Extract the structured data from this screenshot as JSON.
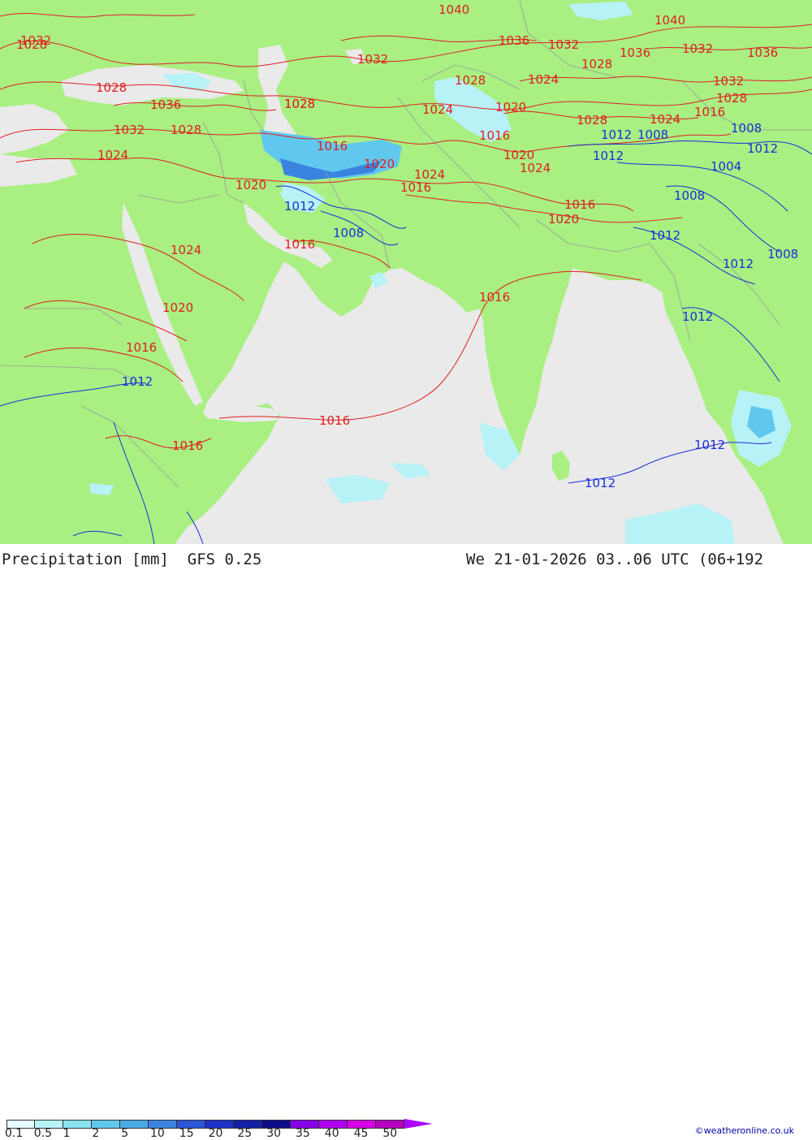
{
  "colors": {
    "land": "#a9ef82",
    "sea": "#eaeaea",
    "high_pressure_isobar": "#e02020",
    "low_pressure_isobar": "#1a2fd6",
    "precip_light": "#b7f2f7",
    "precip_moderate": "#60c8ee",
    "precip_heavy": "#3a84df"
  },
  "footer": {
    "title": "Precipitation [mm]  GFS 0.25",
    "valid_time": "We 21-01-2026 03..06 UTC (06+192",
    "credit": "©weatheronline.co.uk"
  },
  "legend": {
    "labels": [
      "0.1",
      "0.5",
      "1",
      "2",
      "5",
      "10",
      "15",
      "20",
      "25",
      "30",
      "35",
      "40",
      "45",
      "50"
    ],
    "colors": [
      "#e6fffe",
      "#b7f2f7",
      "#8ae4f0",
      "#60c8ee",
      "#4aaae6",
      "#3a84df",
      "#2c56d8",
      "#1e30c8",
      "#141fa6",
      "#0c0c8a",
      "#8600e8",
      "#b000f0",
      "#d800e6",
      "#b600c0"
    ],
    "tip_color": "#ac00ff"
  },
  "isobar_labels": [
    {
      "text": "1040",
      "kind": "high"
    },
    {
      "text": "1040",
      "kind": "high"
    },
    {
      "text": "1036",
      "kind": "high"
    },
    {
      "text": "1036",
      "kind": "high"
    },
    {
      "text": "1036",
      "kind": "high"
    },
    {
      "text": "1036",
      "kind": "high"
    },
    {
      "text": "1032",
      "kind": "high"
    },
    {
      "text": "1032",
      "kind": "high"
    },
    {
      "text": "1032",
      "kind": "high"
    },
    {
      "text": "1032",
      "kind": "high"
    },
    {
      "text": "1032",
      "kind": "high"
    },
    {
      "text": "1032",
      "kind": "high"
    },
    {
      "text": "1028",
      "kind": "high"
    },
    {
      "text": "1028",
      "kind": "high"
    },
    {
      "text": "1028",
      "kind": "high"
    },
    {
      "text": "1028",
      "kind": "high"
    },
    {
      "text": "1028",
      "kind": "high"
    },
    {
      "text": "1028",
      "kind": "high"
    },
    {
      "text": "1028",
      "kind": "high"
    },
    {
      "text": "1028",
      "kind": "high"
    },
    {
      "text": "1028",
      "kind": "high"
    },
    {
      "text": "1024",
      "kind": "high"
    },
    {
      "text": "1024",
      "kind": "high"
    },
    {
      "text": "1024",
      "kind": "high"
    },
    {
      "text": "1024",
      "kind": "high"
    },
    {
      "text": "1024",
      "kind": "high"
    },
    {
      "text": "1024",
      "kind": "high"
    },
    {
      "text": "1024",
      "kind": "high"
    },
    {
      "text": "1020",
      "kind": "high"
    },
    {
      "text": "1020",
      "kind": "high"
    },
    {
      "text": "1020",
      "kind": "high"
    },
    {
      "text": "1020",
      "kind": "high"
    },
    {
      "text": "1020",
      "kind": "high"
    },
    {
      "text": "1020",
      "kind": "high"
    },
    {
      "text": "1016",
      "kind": "high"
    },
    {
      "text": "1016",
      "kind": "high"
    },
    {
      "text": "1016",
      "kind": "high"
    },
    {
      "text": "1016",
      "kind": "high"
    },
    {
      "text": "1016",
      "kind": "high"
    },
    {
      "text": "1016",
      "kind": "high"
    },
    {
      "text": "1016",
      "kind": "high"
    },
    {
      "text": "1016",
      "kind": "high"
    },
    {
      "text": "1016",
      "kind": "high"
    },
    {
      "text": "1016",
      "kind": "high"
    },
    {
      "text": "1012",
      "kind": "low"
    },
    {
      "text": "1008",
      "kind": "low"
    },
    {
      "text": "1008",
      "kind": "low"
    },
    {
      "text": "1012",
      "kind": "low"
    },
    {
      "text": "1004",
      "kind": "low"
    },
    {
      "text": "1012",
      "kind": "low"
    },
    {
      "text": "1008",
      "kind": "low"
    },
    {
      "text": "1012",
      "kind": "low"
    },
    {
      "text": "1012",
      "kind": "low"
    },
    {
      "text": "1008",
      "kind": "low"
    },
    {
      "text": "1012",
      "kind": "low"
    },
    {
      "text": "1012",
      "kind": "low"
    },
    {
      "text": "1008",
      "kind": "low"
    },
    {
      "text": "1012",
      "kind": "low"
    },
    {
      "text": "1012",
      "kind": "low"
    },
    {
      "text": "1012",
      "kind": "low"
    }
  ]
}
